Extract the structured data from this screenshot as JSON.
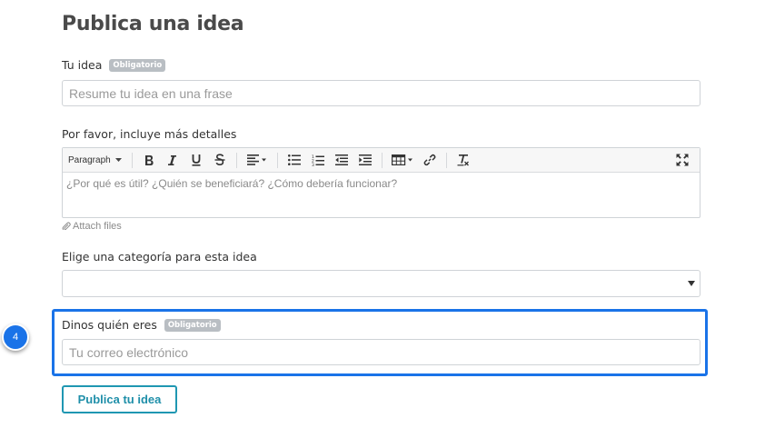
{
  "page": {
    "title": "Publica una idea"
  },
  "idea_field": {
    "label": "Tu idea",
    "badge": "Obligatorio",
    "placeholder": "Resume tu idea en una frase",
    "value": ""
  },
  "details_field": {
    "label": "Por favor, incluye más detalles",
    "toolbar": {
      "paragraph_label": "Paragraph",
      "buttons": [
        "bold-icon",
        "italic-icon",
        "underline-icon",
        "strikethrough-icon",
        "align-icon",
        "bulleted-list-icon",
        "numbered-list-icon",
        "outdent-icon",
        "indent-icon",
        "table-icon",
        "link-icon",
        "clear-format-icon",
        "fullscreen-icon"
      ]
    },
    "placeholder": "¿Por qué es útil? ¿Quién se beneficiará? ¿Cómo debería funcionar?",
    "attach_label": "Attach files"
  },
  "category_field": {
    "label": "Elige una categoría para esta idea",
    "selected": ""
  },
  "email_field": {
    "label": "Dinos quién eres",
    "badge": "Obligatorio",
    "placeholder": "Tu correo electrónico",
    "value": ""
  },
  "step_marker": {
    "number": "4",
    "color": "#1a73e8"
  },
  "submit": {
    "label": "Publica tu idea",
    "color": "#1f97b2"
  }
}
